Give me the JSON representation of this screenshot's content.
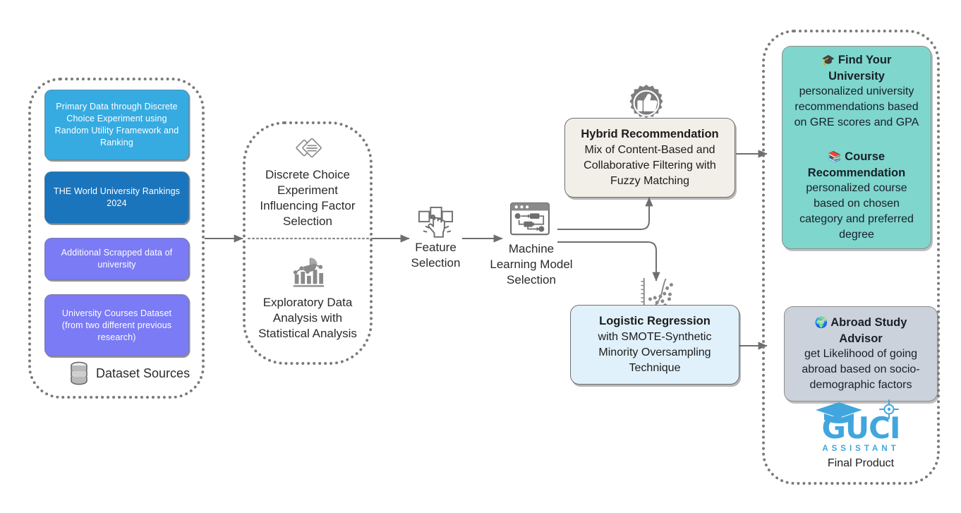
{
  "diagram": {
    "title": "GUCI Assistant system pipeline",
    "colors": {
      "light_blue": "#35ABE2",
      "dark_blue": "#1B75BC",
      "purple": "#7B7BF5",
      "teal": "#7FD6CC",
      "slate": "#CBD2DB",
      "cream": "#F2EFE9",
      "pale_blue": "#E1F1FB",
      "stroke_gray": "#7a7a7a",
      "arrow_gray": "#6e6e6e",
      "brand_blue": "#41A6DE"
    }
  },
  "data_sources": {
    "group_label": "Dataset Sources",
    "group_icon": "database-icon",
    "cards": [
      {
        "label": "Primary Data through Discrete Choice Experiment using Random Utility Framework and Ranking",
        "color": "#35ABE2"
      },
      {
        "label": "THE World University Rankings 2024",
        "color": "#1B75BC"
      },
      {
        "label": "Additional Scrapped data of university",
        "color": "#7B7BF5"
      },
      {
        "label": "University Courses Dataset (from two different previous research)",
        "color": "#7B7BF5"
      }
    ]
  },
  "analysis": {
    "top": {
      "icon": "diamond-layers-icon",
      "label": "Discrete Choice Experiment Influencing Factor Selection"
    },
    "bottom": {
      "icon": "bar-chart-analytics-icon",
      "label": "Exploratory Data Analysis with Statistical Analysis"
    }
  },
  "pipeline": {
    "feature_selection": {
      "icon": "hand-select-squares-icon",
      "label": "Feature Selection"
    },
    "model_selection": {
      "icon": "ml-workflow-window-icon",
      "label": "Machine Learning Model Selection"
    }
  },
  "models": {
    "hybrid": {
      "icon": "thumbs-up-badge-icon",
      "title": "Hybrid Recommendation",
      "body": "Mix of Content-Based  and Collaborative Filtering with Fuzzy Matching",
      "color": "#F2EFE9"
    },
    "logistic": {
      "icon": "scatter-regression-icon",
      "title": "Logistic Regression",
      "body": "with SMOTE-Synthetic Minority Oversampling Technique",
      "color": "#E1F1FB"
    }
  },
  "outputs": {
    "recommendation_card": {
      "color": "#7FD6CC",
      "blocks": [
        {
          "emoji": "🎓",
          "icon": "graduation-cap-icon",
          "title": "Find Your University",
          "body": "personalized university recommendations based on GRE scores and GPA"
        },
        {
          "emoji": "📚",
          "icon": "books-icon",
          "title": "Course Recommendation",
          "body": "personalized course based on chosen category and preferred degree"
        }
      ]
    },
    "advisor_card": {
      "color": "#CBD2DB",
      "emoji": "🌍",
      "icon": "globe-icon",
      "title": "Abroad Study Advisor",
      "body": "get Likelihood of going abroad based on socio-demographic factors"
    },
    "brand": {
      "logo_icon": "guci-graduation-logo",
      "wordmark": "GUCI",
      "tagline": "ASSISTANT",
      "caption": "Final Product"
    }
  }
}
